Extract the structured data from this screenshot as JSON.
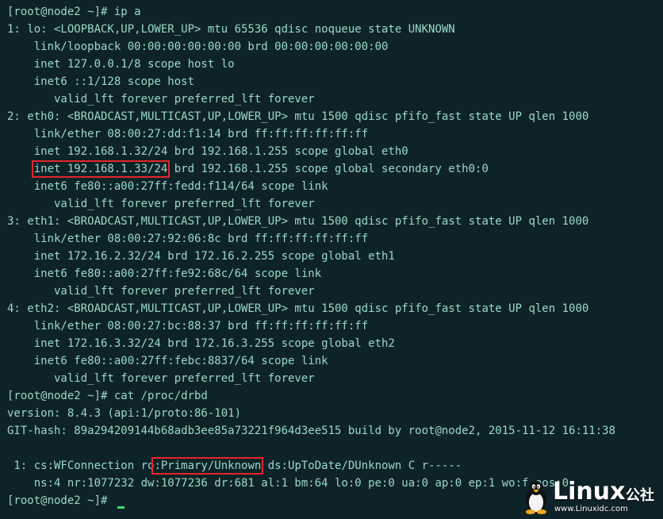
{
  "terminal": {
    "lines": [
      "[root@node2 ~]# ip a",
      "1: lo: <LOOPBACK,UP,LOWER_UP> mtu 65536 qdisc noqueue state UNKNOWN",
      "    link/loopback 00:00:00:00:00:00 brd 00:00:00:00:00:00",
      "    inet 127.0.0.1/8 scope host lo",
      "    inet6 ::1/128 scope host",
      "       valid_lft forever preferred_lft forever",
      "2: eth0: <BROADCAST,MULTICAST,UP,LOWER_UP> mtu 1500 qdisc pfifo_fast state UP qlen 1000",
      "    link/ether 08:00:27:dd:f1:14 brd ff:ff:ff:ff:ff:ff",
      "    inet 192.168.1.32/24 brd 192.168.1.255 scope global eth0",
      {
        "pre": "    ",
        "hl": "inet 192.168.1.33/24",
        "post": " brd 192.168.1.255 scope global secondary eth0:0"
      },
      "    inet6 fe80::a00:27ff:fedd:f114/64 scope link",
      "       valid_lft forever preferred_lft forever",
      "3: eth1: <BROADCAST,MULTICAST,UP,LOWER_UP> mtu 1500 qdisc pfifo_fast state UP qlen 1000",
      "    link/ether 08:00:27:92:06:8c brd ff:ff:ff:ff:ff:ff",
      "    inet 172.16.2.32/24 brd 172.16.2.255 scope global eth1",
      "    inet6 fe80::a00:27ff:fe92:68c/64 scope link",
      "       valid_lft forever preferred_lft forever",
      "4: eth2: <BROADCAST,MULTICAST,UP,LOWER_UP> mtu 1500 qdisc pfifo_fast state UP qlen 1000",
      "    link/ether 08:00:27:bc:88:37 brd ff:ff:ff:ff:ff:ff",
      "    inet 172.16.3.32/24 brd 172.16.3.255 scope global eth2",
      "    inet6 fe80::a00:27ff:febc:8837/64 scope link",
      "       valid_lft forever preferred_lft forever",
      "[root@node2 ~]# cat /proc/drbd",
      "version: 8.4.3 (api:1/proto:86-101)",
      "GIT-hash: 89a294209144b68adb3ee85a73221f964d3ee515 build by root@node2, 2015-11-12 16:11:38",
      "",
      {
        "pre": " 1: cs:WFConnection ro",
        "hl": ":Primary/Unknown",
        "post": " ds:UpToDate/DUnknown C r-----"
      },
      "    ns:4 nr:1077232 dw:1077236 dr:681 al:1 bm:64 lo:0 pe:0 ua:0 ap:0 ep:1 wo:f oos:0",
      {
        "prompt": "[root@node2 ~]# ",
        "cursor": true
      }
    ]
  },
  "watermark": {
    "title": "Linux",
    "cn": "公社",
    "url": "www.Linuxidc.com",
    "icon": "tux-penguin-icon"
  },
  "colors": {
    "background": "#0e2328",
    "text": "#9ad9c9",
    "highlight_box": "#e3262a",
    "cursor": "#38e06b"
  }
}
